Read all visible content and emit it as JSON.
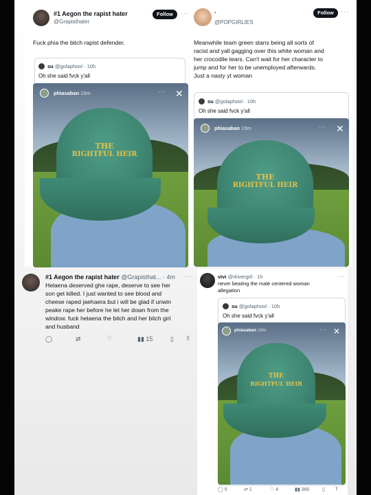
{
  "tweets": {
    "top_left": {
      "display_name": "#1 Aegon the rapist hater",
      "handle": "@Grapisthater",
      "follow_label": "Follow",
      "text": "Fuck phia the bitch rapist defender."
    },
    "top_right": {
      "display_name": ".",
      "handle": "@POPGIRLIES",
      "follow_label": "Follow",
      "text_lines": [
        "Meanwhile team green stans being all sorts of",
        "racist and yall gagging over this white woman and",
        "her crocodile tears. Can't wait for her character to",
        "jump and for her to be unemployed afterwards.",
        "Just a nasty yt woman"
      ]
    },
    "bottom_left": {
      "display_name": "#1 Aegon the rapist hater",
      "handle": "@Grapisthat...",
      "time": "4m",
      "text_lines": [
        "Helaena deserved ghe rape, deserve to see her",
        "son get killed. I just wanted to see blood and",
        "cheese raped jaehaera but i will be glad if unwin",
        "peake rape her before he let her down from the",
        "window. fuck helaena the bitch and her bitch girl",
        "and husband"
      ],
      "views": "15"
    },
    "bottom_right": {
      "display_name": "vivi",
      "handle": "@rkivergirl",
      "time": "1h",
      "text_lines": [
        "never beating the male centered woman",
        "allegation"
      ],
      "actions": [
        "5",
        "1",
        "4",
        "360"
      ]
    }
  },
  "quoted": {
    "name": "su",
    "handle": "@golaphool",
    "time": "10h",
    "text": "Oh she said fvck y'all"
  },
  "story": {
    "username": "phiasaban",
    "time": "19m",
    "cap_line1": "THE",
    "cap_line2": "RIGHTFUL HEIR"
  },
  "colors": {
    "cap": "#3e8672",
    "embroidery": "#e2c24b",
    "follow_button": "#0f1419"
  }
}
